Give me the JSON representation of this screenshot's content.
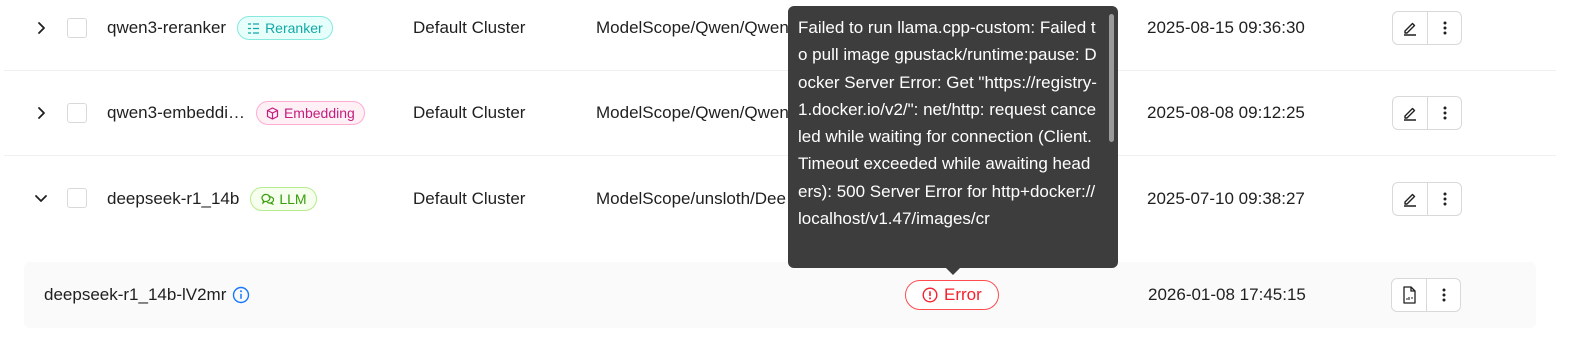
{
  "models": [
    {
      "name": "qwen3-reranker",
      "tag": {
        "label": "Reranker",
        "icon": "list-sort-icon",
        "color": "#13a8a8"
      },
      "cluster": "Default Cluster",
      "source": "ModelScope/Qwen/Qwen",
      "created": "2025-08-15 09:36:30",
      "expanded": false
    },
    {
      "name": "qwen3-embeddi…",
      "tag": {
        "label": "Embedding",
        "icon": "cube-icon",
        "color": "#c41d7f"
      },
      "cluster": "Default Cluster",
      "source": "ModelScope/Qwen/Qwen",
      "created": "2025-08-08 09:12:25",
      "expanded": false
    },
    {
      "name": "deepseek-r1_14b",
      "tag": {
        "label": "LLM",
        "icon": "chat-bubbles-icon",
        "color": "#389e0d"
      },
      "cluster": "Default Cluster",
      "source": "ModelScope/unsloth/Dee",
      "created": "2025-07-10 09:38:27",
      "expanded": true
    }
  ],
  "instance": {
    "name": "deepseek-r1_14b-lV2mr",
    "status": "Error",
    "status_color": "#f5222d",
    "created": "2026-01-08 17:45:15"
  },
  "tooltip": {
    "text": "Failed to run llama.cpp-custom: Failed to pull image gpustack/runtime:pause: Docker Server Error: Get \"https://registry-1.docker.io/v2/\": net/http: request canceled while waiting for connection (Client.Timeout exceeded while awaiting headers): 500 Server Error for http+docker://localhost/v1.47/images/cr"
  }
}
